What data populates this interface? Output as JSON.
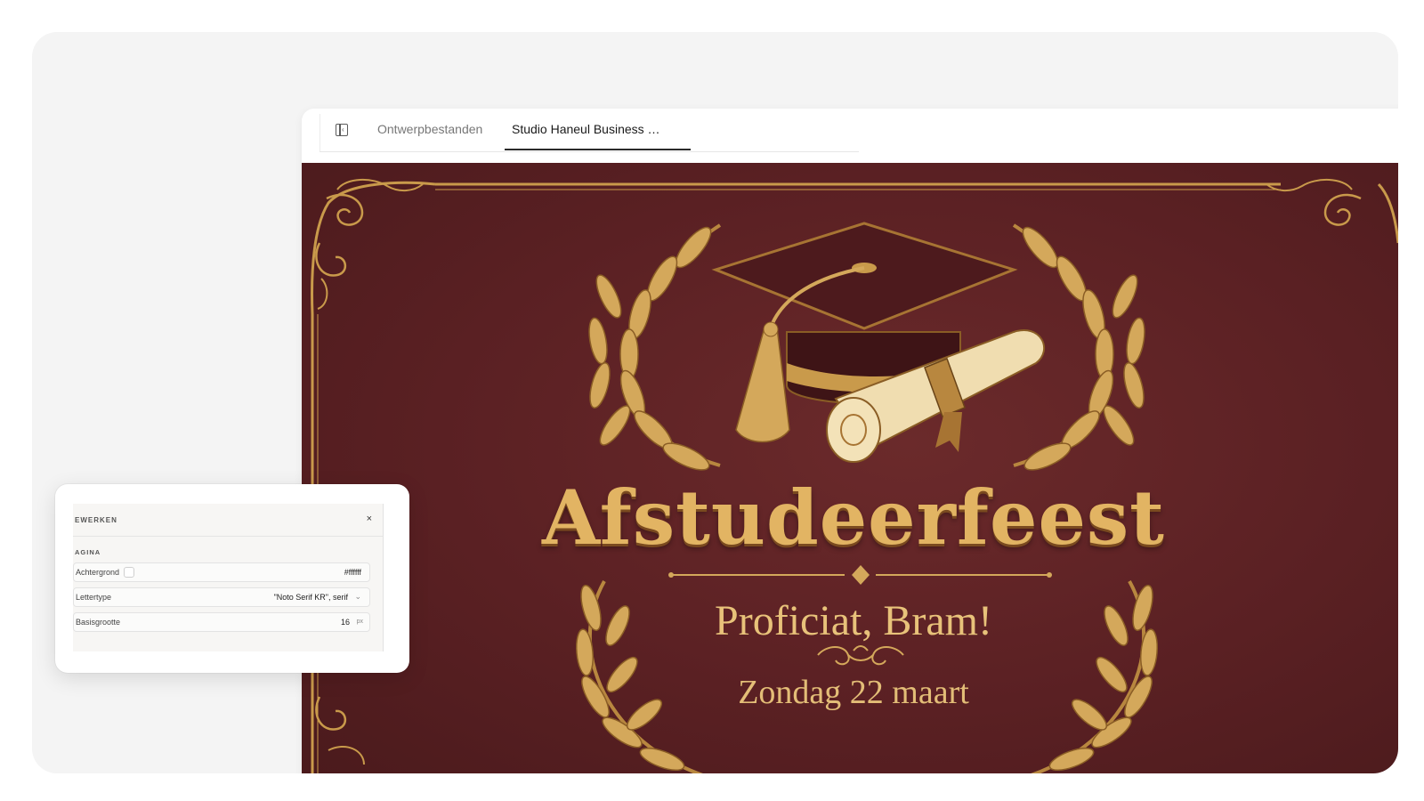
{
  "tabs": [
    {
      "label": "Ontwerpbestanden",
      "active": false
    },
    {
      "label": "Studio Haneul Business …",
      "active": true
    }
  ],
  "icons": {
    "sidebar_toggle": "sidebar-collapse-icon",
    "close": "close-icon",
    "dropdown": "chevron-down-icon"
  },
  "canvas": {
    "title": "Afstudeerfeest",
    "subtitle": "Proficiat, Bram!",
    "date": "Zondag 22 maart",
    "colors": {
      "background": "#5a2023",
      "gold": "#e2b463"
    }
  },
  "panel": {
    "header": "EWERKEN",
    "close_glyph": "×",
    "section": "AGINA",
    "rows": [
      {
        "label": "Achtergrond",
        "value": "#ffffff"
      },
      {
        "label": "Lettertype",
        "value": "\"Noto Serif KR\", serif",
        "dropdown_glyph": "⌄"
      },
      {
        "label": "Basisgrootte",
        "value": "16",
        "unit": "px"
      }
    ]
  }
}
